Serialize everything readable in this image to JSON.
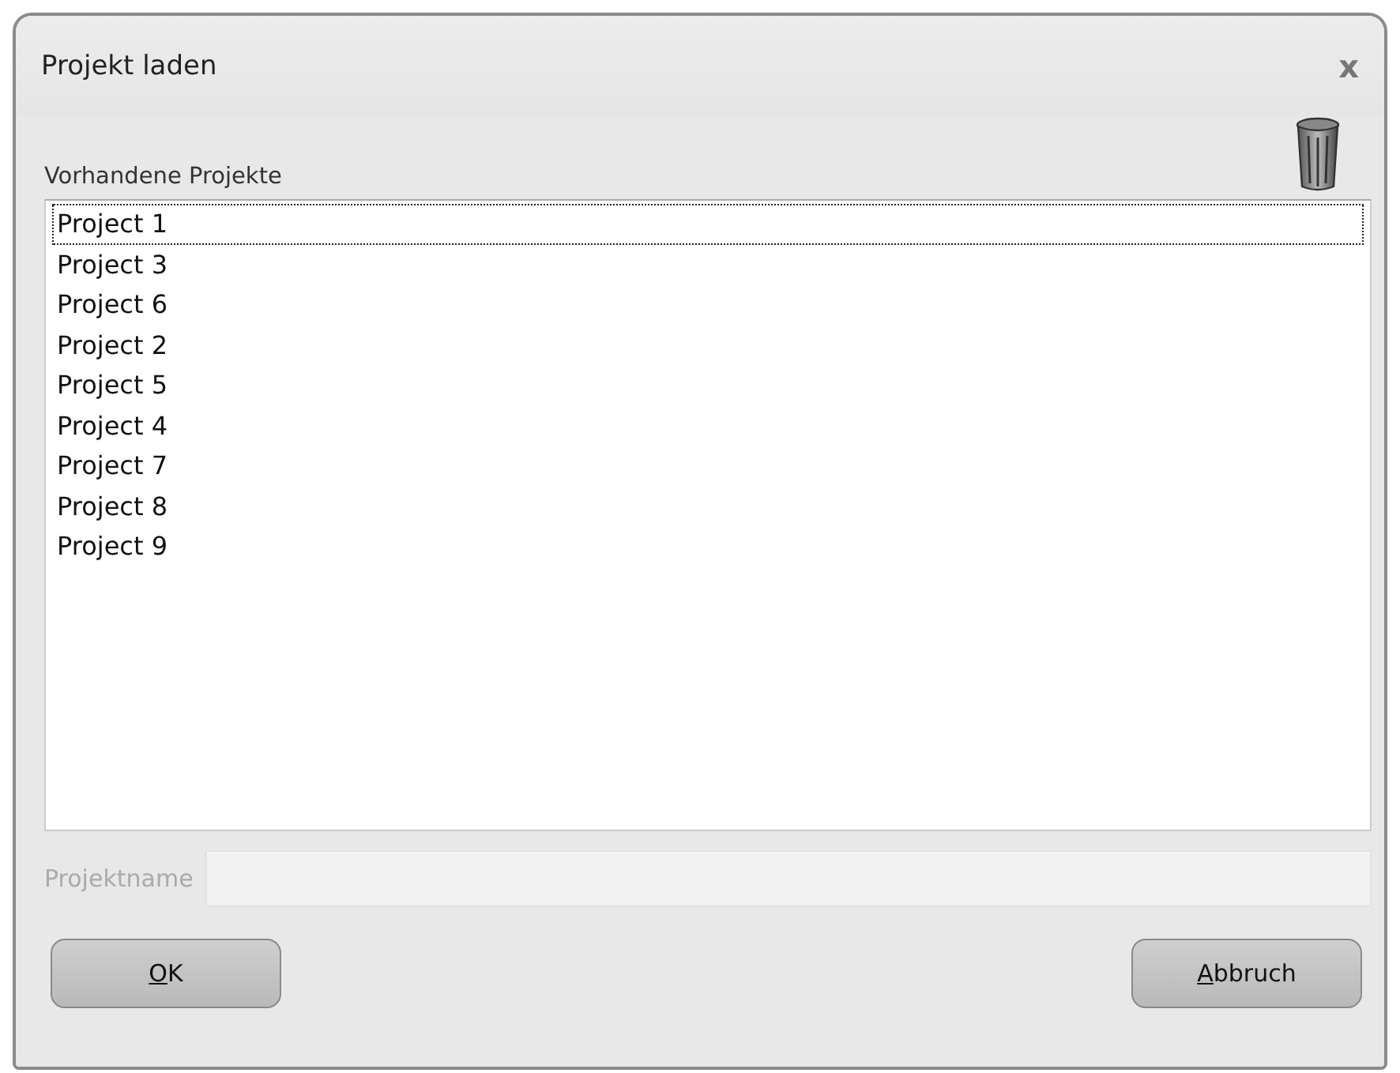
{
  "window": {
    "title": "Projekt laden",
    "close": "x"
  },
  "projects": {
    "label": "Vorhandene Projekte",
    "items": [
      {
        "name": "Project 1",
        "focused": true
      },
      {
        "name": "Project 3",
        "focused": false
      },
      {
        "name": "Project 6",
        "focused": false
      },
      {
        "name": "Project 2",
        "focused": false
      },
      {
        "name": "Project 5",
        "focused": false
      },
      {
        "name": "Project 4",
        "focused": false
      },
      {
        "name": "Project 7",
        "focused": false
      },
      {
        "name": "Project 8",
        "focused": false
      },
      {
        "name": "Project 9",
        "focused": false
      }
    ]
  },
  "name_field": {
    "label": "Projektname",
    "disabled": true
  },
  "buttons": [
    {
      "label": "OK",
      "underline_first": true
    },
    {
      "label": "Abbruch",
      "underline_first": true
    }
  ]
}
